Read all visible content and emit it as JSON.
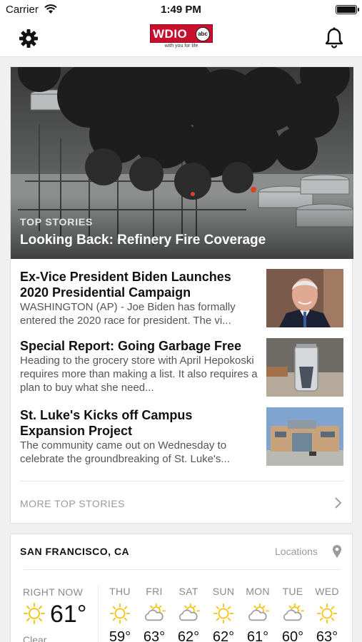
{
  "status_bar": {
    "carrier": "Carrier",
    "time": "1:49 PM"
  },
  "nav": {
    "left_icon": "gear-icon",
    "right_icon": "bell-icon",
    "logo": {
      "text": "WDIO",
      "network": "abc",
      "tagline": "with you for life"
    }
  },
  "hero": {
    "kicker": "TOP STORIES",
    "title": "Looking Back: Refinery Fire Coverage"
  },
  "stories": [
    {
      "title": "Ex-Vice President Biden Launches 2020 Presidential Campaign",
      "summary": "WASHINGTON (AP) - Joe Biden has formally entered the 2020 race for president. The vi..."
    },
    {
      "title": "Special Report: Going Garbage Free",
      "summary": "Heading to the grocery store with April Hepokoski requires more than making a list. It also requires a plan to buy what she need..."
    },
    {
      "title": "St. Luke's Kicks off Campus Expansion Project",
      "summary": "The community came out on Wednesday to celebrate the groundbreaking of St. Luke's..."
    }
  ],
  "more_top_stories": "MORE TOP STORIES",
  "weather": {
    "city": "SAN FRANCISCO, CA",
    "locations_label": "Locations",
    "right_now_label": "RIGHT NOW",
    "current_temp": "61°",
    "current_condition": "Clear",
    "forecast": [
      {
        "day": "THU",
        "icon": "sun-icon",
        "high": "59°"
      },
      {
        "day": "FRI",
        "icon": "partly-cloudy-icon",
        "high": "63°"
      },
      {
        "day": "SAT",
        "icon": "partly-cloudy-icon",
        "high": "62°"
      },
      {
        "day": "SUN",
        "icon": "sun-icon",
        "high": "62°"
      },
      {
        "day": "MON",
        "icon": "partly-cloudy-icon",
        "high": "61°"
      },
      {
        "day": "TUE",
        "icon": "partly-cloudy-icon",
        "high": "60°"
      },
      {
        "day": "WED",
        "icon": "sun-icon",
        "high": "63°"
      }
    ]
  },
  "colors": {
    "brand_red": "#c8102e",
    "sun_yellow": "#f5c518",
    "muted_text": "#8a8a8a"
  }
}
